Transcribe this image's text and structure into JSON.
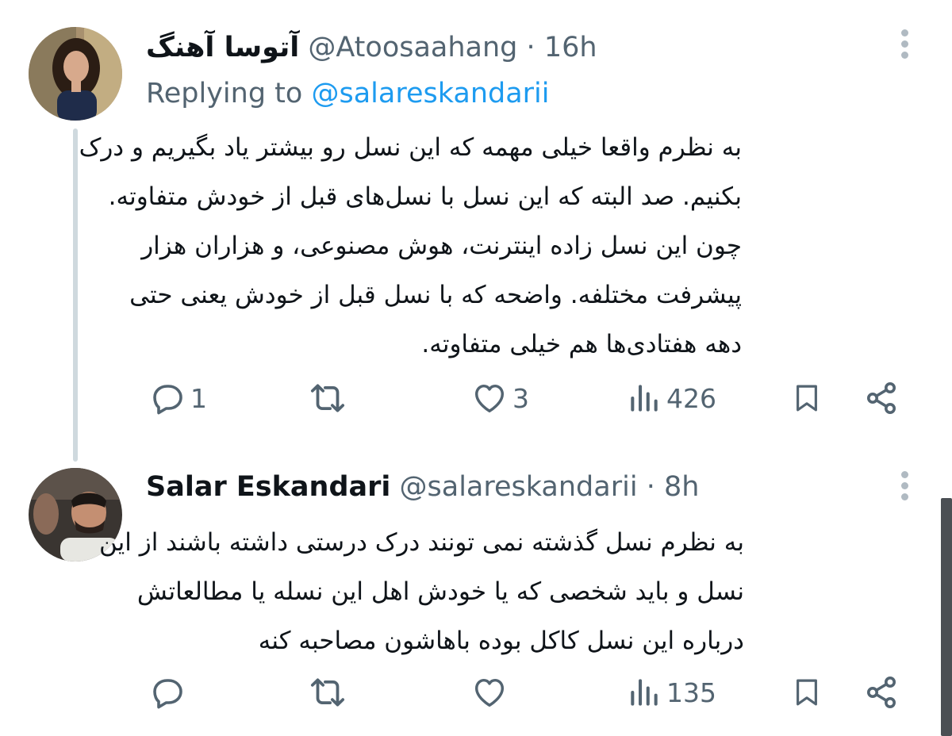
{
  "tweets": [
    {
      "display_name": "آتوسا آهنگ",
      "handle": "@Atoosaahang",
      "separator": "·",
      "time": "16h",
      "replying_prefix": "Replying to",
      "replying_to": "@salareskandarii",
      "lines": [
        "به نظرم واقعا خیلی مهمه که این نسل رو بیشتر یاد بگیریم و درک",
        "بکنیم. صد البته که این نسل با نسل‌های قبل از خودش متفاوته.",
        "چون این نسل زاده اینترنت، هوش مصنوعی، و هزاران هزار",
        "پیشرفت مختلفه. واضحه که با نسل قبل از خودش یعنی حتی",
        "دهه هفتادی‌ها هم خیلی متفاوته."
      ],
      "replies": "1",
      "retweets": "",
      "likes": "3",
      "views": "426"
    },
    {
      "display_name": "Salar Eskandari",
      "handle": "@salareskandarii",
      "separator": "·",
      "time": "8h",
      "lines": [
        "به نظرم نسل گذشته نمی تونند درک درستی داشته باشند از این",
        "نسل و باید شخصی که یا خودش اهل این نسله یا مطالعاتش",
        "درباره این نسل کاکل بوده باهاشون مصاحبه کنه"
      ],
      "replies": "",
      "retweets": "",
      "likes": "",
      "views": "135"
    }
  ],
  "icons": {
    "reply": "reply-icon",
    "retweet": "retweet-icon",
    "like": "heart-icon",
    "views": "views-icon",
    "bookmark": "bookmark-icon",
    "share": "share-icon",
    "more": "more-icon"
  },
  "colors": {
    "text": "#0f1419",
    "secondary": "#536471",
    "link": "#1d9bf0",
    "thread_line": "#cfd9de"
  }
}
